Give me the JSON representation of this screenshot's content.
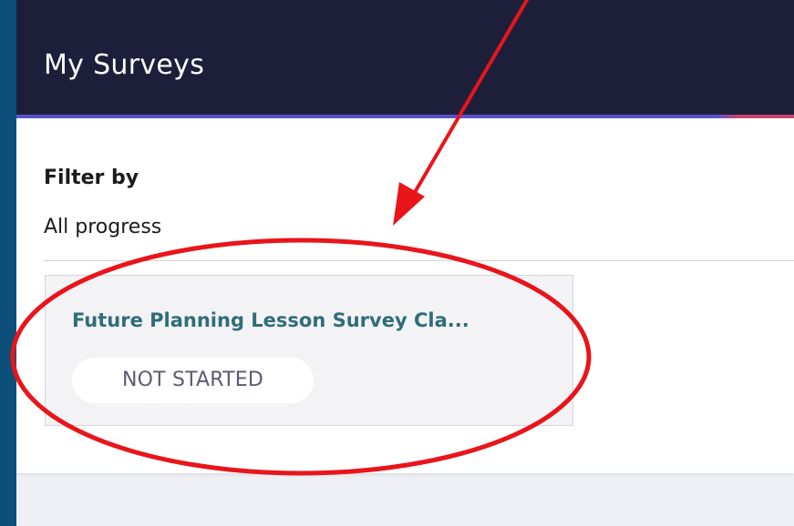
{
  "header": {
    "title": "My Surveys"
  },
  "filter": {
    "heading": "Filter by",
    "selected_value": "All progress"
  },
  "surveys": [
    {
      "title": "Future Planning Lesson Survey Cla...",
      "status": "NOT STARTED"
    }
  ],
  "colors": {
    "outer_background": "#0b4f7a",
    "header_background": "#1d1f3a",
    "accent_primary": "#5a52c9",
    "accent_secondary": "#c8466a",
    "survey_title": "#2e6e7a",
    "annotation_red": "#e8151b"
  }
}
